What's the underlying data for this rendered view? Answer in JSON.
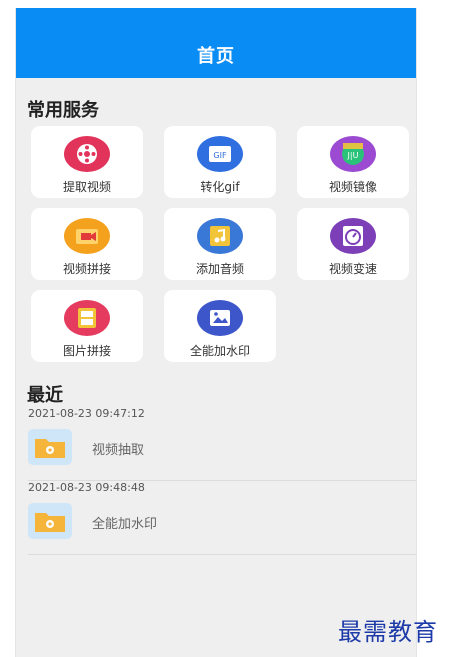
{
  "header": {
    "title": "首页"
  },
  "services": {
    "title": "常用服务",
    "items": [
      {
        "label": "提取视频",
        "icon": "film-reel-icon",
        "bg": "#e2335a",
        "inner": "#ffffff"
      },
      {
        "label": "转化gif",
        "icon": "gif-icon",
        "bg": "#2f6fe0",
        "inner": "#ffffff"
      },
      {
        "label": "视频镜像",
        "icon": "mirror-icon",
        "bg": "#9b4ad1",
        "inner": "#2bc27a"
      },
      {
        "label": "视频拼接",
        "icon": "video-camera-icon",
        "bg": "#f4a11d",
        "inner": "#e23a3a"
      },
      {
        "label": "添加音频",
        "icon": "music-note-icon",
        "bg": "#3a78d8",
        "inner": "#f2c43a"
      },
      {
        "label": "视频变速",
        "icon": "speedometer-icon",
        "bg": "#7d3fb8",
        "inner": "#ffffff"
      },
      {
        "label": "图片拼接",
        "icon": "picture-collage-icon",
        "bg": "#e43b5e",
        "inner": "#f2c43a"
      },
      {
        "label": "全能加水印",
        "icon": "watermark-icon",
        "bg": "#3d56c9",
        "inner": "#ffffff"
      }
    ]
  },
  "recent": {
    "title": "最近",
    "entries": [
      {
        "time": "2021-08-23 09:47:12",
        "name": "视频抽取",
        "icon": "folder-icon"
      },
      {
        "time": "2021-08-23 09:48:48",
        "name": "全能加水印",
        "icon": "folder-icon"
      }
    ]
  },
  "watermark": {
    "text": "最需教育"
  }
}
